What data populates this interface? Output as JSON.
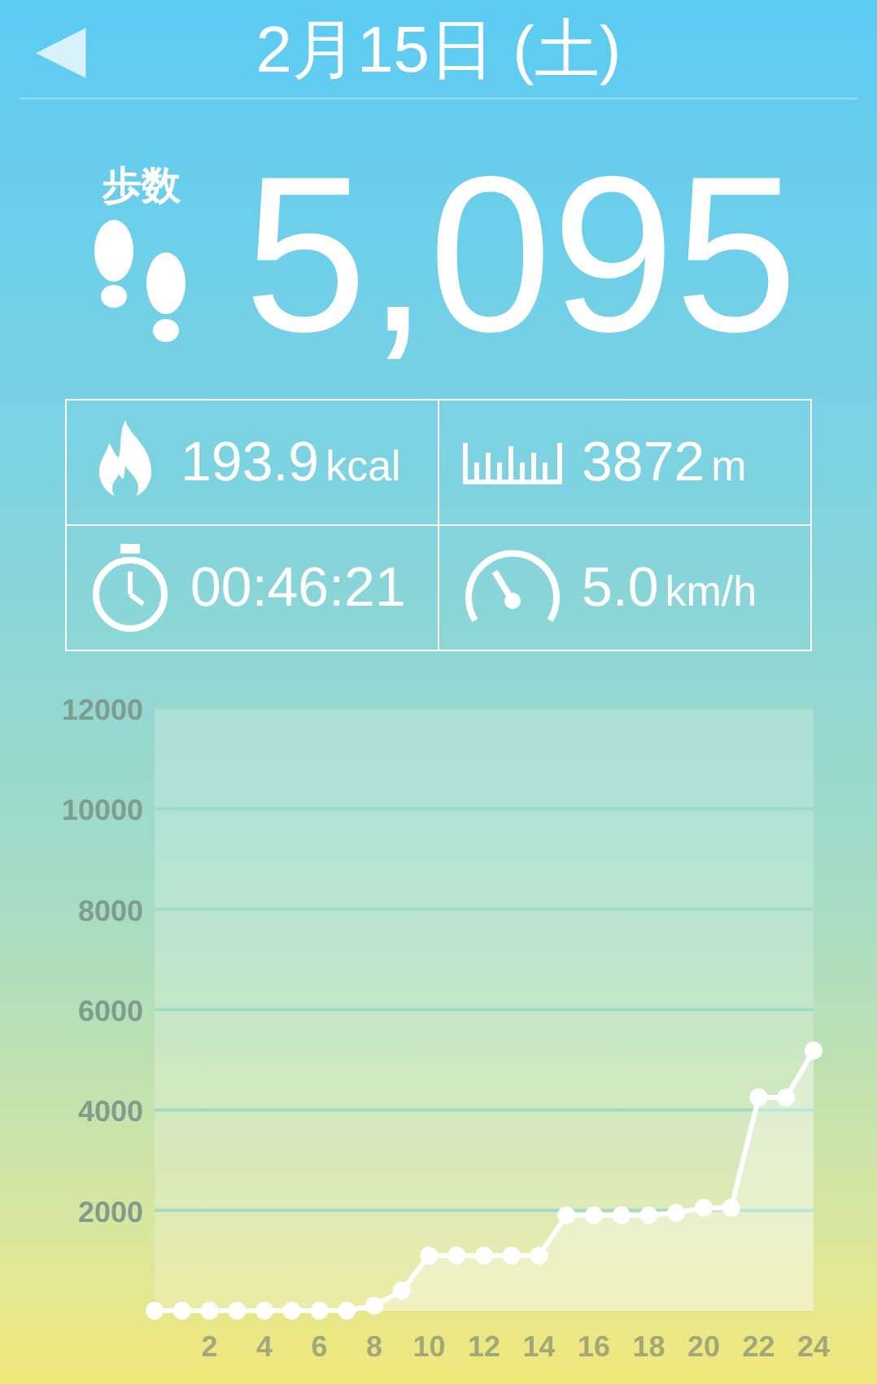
{
  "header": {
    "back": "◀",
    "title": "2月15日 (土)"
  },
  "steps": {
    "label": "歩数",
    "value": "5,095"
  },
  "stats": [
    {
      "kind": "calories",
      "value": "193.9",
      "unit": "kcal"
    },
    {
      "kind": "distance",
      "value": "3872",
      "unit": "m"
    },
    {
      "kind": "time",
      "value": "00:46:21"
    },
    {
      "kind": "speed",
      "value": "5.0",
      "unit": "km/h"
    }
  ],
  "chart_data": {
    "type": "area",
    "x": [
      0,
      1,
      2,
      3,
      4,
      5,
      6,
      7,
      8,
      9,
      10,
      11,
      12,
      13,
      14,
      15,
      16,
      17,
      18,
      19,
      20,
      21,
      22,
      23,
      24
    ],
    "series": [
      {
        "color": "#ffffff",
        "values": [
          0,
          0,
          0,
          0,
          0,
          0,
          0,
          0,
          100,
          400,
          1100,
          1100,
          1100,
          1100,
          1100,
          1900,
          1900,
          1900,
          1900,
          1950,
          2050,
          2050,
          4250,
          4250,
          5180
        ]
      }
    ],
    "grid": true,
    "xlim": [
      0,
      24
    ],
    "ylim": [
      0,
      12000
    ],
    "xticks": [
      2,
      4,
      6,
      8,
      10,
      12,
      14,
      16,
      18,
      20,
      22,
      24
    ],
    "yticks": [
      2000,
      4000,
      6000,
      8000,
      10000,
      12000
    ]
  }
}
